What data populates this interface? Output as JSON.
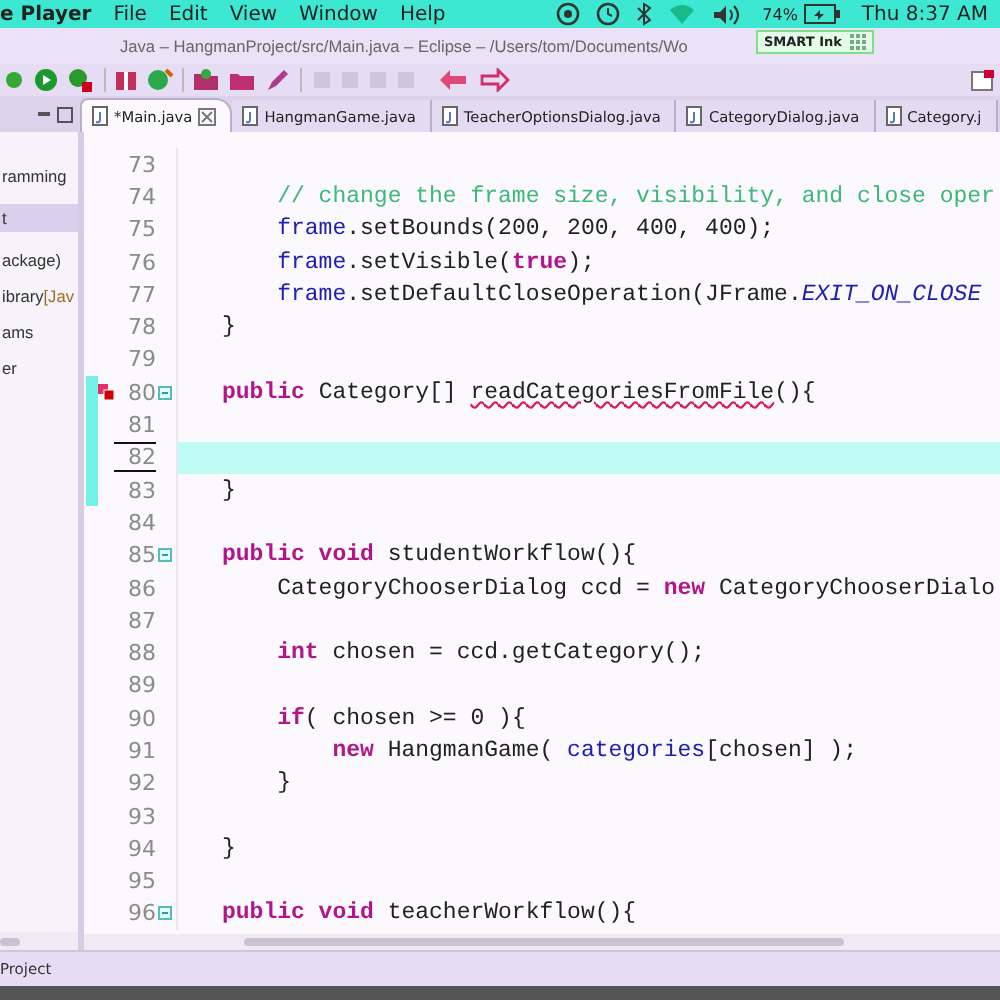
{
  "menu_bar": {
    "app": "e Player",
    "items": [
      "File",
      "Edit",
      "View",
      "Window",
      "Help"
    ],
    "battery": "74%",
    "clock": "Thu 8:37 AM"
  },
  "window": {
    "title": "Java – HangmanProject/src/Main.java – Eclipse – /Users/tom/Documents/Wo"
  },
  "overlay": {
    "title": "SMART Ink"
  },
  "tabs": [
    {
      "label": "*Main.java",
      "selected": true
    },
    {
      "label": "HangmanGame.java",
      "selected": false
    },
    {
      "label": "TeacherOptionsDialog.java",
      "selected": false
    },
    {
      "label": "CategoryDialog.java",
      "selected": false
    },
    {
      "label": "Category.j",
      "selected": false
    }
  ],
  "explorer": {
    "items": [
      {
        "label": "ramming",
        "selected": false
      },
      {
        "label": "t",
        "selected": true
      },
      {
        "label": "ackage)",
        "selected": false
      },
      {
        "label": "ibrary",
        "suffix": "[Jav",
        "selected": false
      },
      {
        "label": "ams",
        "selected": false
      },
      {
        "label": "er",
        "selected": false
      }
    ]
  },
  "editor": {
    "lines": [
      {
        "number": "73",
        "current": false,
        "fold": false,
        "marker": false
      },
      {
        "number": "74",
        "current": false,
        "fold": false,
        "marker": false,
        "segments": [
          {
            "text": "    // change the frame size, visibility, and close oper",
            "kind": "comment"
          }
        ]
      },
      {
        "number": "75",
        "current": false,
        "fold": false,
        "marker": false,
        "segments": [
          {
            "text": "    frame",
            "kind": "field"
          },
          {
            "text": ".setBounds(200, 200, 400, 400);",
            "kind": "plain"
          }
        ]
      },
      {
        "number": "76",
        "current": false,
        "fold": false,
        "marker": false,
        "segments": [
          {
            "text": "    frame",
            "kind": "field"
          },
          {
            "text": ".setVisible(",
            "kind": "plain"
          },
          {
            "text": "true",
            "kind": "keyword"
          },
          {
            "text": ");",
            "kind": "plain"
          }
        ]
      },
      {
        "number": "77",
        "current": false,
        "fold": false,
        "marker": false,
        "segments": [
          {
            "text": "    frame",
            "kind": "field"
          },
          {
            "text": ".setDefaultCloseOperation(JFrame.",
            "kind": "plain"
          },
          {
            "text": "EXIT_ON_CLOSE",
            "kind": "constant"
          }
        ]
      },
      {
        "number": "78",
        "current": false,
        "fold": false,
        "marker": false,
        "segments": [
          {
            "text": "}",
            "kind": "plain"
          }
        ]
      },
      {
        "number": "79",
        "current": false,
        "fold": false,
        "marker": false
      },
      {
        "number": "80",
        "current": false,
        "fold": true,
        "marker": true,
        "segments": [
          {
            "text": "public",
            "kind": "keyword"
          },
          {
            "text": " Category[] ",
            "kind": "plain"
          },
          {
            "text": "readCategoriesFromFile",
            "kind": "warning"
          },
          {
            "text": "(){",
            "kind": "plain"
          }
        ]
      },
      {
        "number": "81",
        "current": false,
        "fold": false,
        "marker": false
      },
      {
        "number": "82",
        "current": true,
        "fold": false,
        "marker": false
      },
      {
        "number": "83",
        "current": false,
        "fold": false,
        "marker": false,
        "segments": [
          {
            "text": "}",
            "kind": "plain"
          }
        ]
      },
      {
        "number": "84",
        "current": false,
        "fold": false,
        "marker": false
      },
      {
        "number": "85",
        "current": false,
        "fold": true,
        "marker": false,
        "segments": [
          {
            "text": "public void",
            "kind": "keyword"
          },
          {
            "text": " studentWorkflow(){",
            "kind": "plain"
          }
        ]
      },
      {
        "number": "86",
        "current": false,
        "fold": false,
        "marker": false,
        "segments": [
          {
            "text": "    CategoryChooserDialog ccd = ",
            "kind": "plain"
          },
          {
            "text": "new",
            "kind": "keyword"
          },
          {
            "text": " CategoryChooserDialo",
            "kind": "plain"
          }
        ]
      },
      {
        "number": "87",
        "current": false,
        "fold": false,
        "marker": false
      },
      {
        "number": "88",
        "current": false,
        "fold": false,
        "marker": false,
        "segments": [
          {
            "text": "    int",
            "kind": "keyword"
          },
          {
            "text": " chosen = ccd.getCategory();",
            "kind": "plain"
          }
        ]
      },
      {
        "number": "89",
        "current": false,
        "fold": false,
        "marker": false
      },
      {
        "number": "90",
        "current": false,
        "fold": false,
        "marker": false,
        "segments": [
          {
            "text": "    if",
            "kind": "keyword"
          },
          {
            "text": "( chosen >= 0 ){",
            "kind": "plain"
          }
        ]
      },
      {
        "number": "91",
        "current": false,
        "fold": false,
        "marker": false,
        "segments": [
          {
            "text": "        new",
            "kind": "keyword"
          },
          {
            "text": " HangmanGame( ",
            "kind": "plain"
          },
          {
            "text": "categories",
            "kind": "field"
          },
          {
            "text": "[chosen] );",
            "kind": "plain"
          }
        ]
      },
      {
        "number": "92",
        "current": false,
        "fold": false,
        "marker": false,
        "segments": [
          {
            "text": "    }",
            "kind": "plain"
          }
        ]
      },
      {
        "number": "93",
        "current": false,
        "fold": false,
        "marker": false
      },
      {
        "number": "94",
        "current": false,
        "fold": false,
        "marker": false,
        "segments": [
          {
            "text": "}",
            "kind": "plain"
          }
        ]
      },
      {
        "number": "95",
        "current": false,
        "fold": false,
        "marker": false
      },
      {
        "number": "96",
        "current": false,
        "fold": true,
        "marker": false,
        "segments": [
          {
            "text": "public void",
            "kind": "keyword"
          },
          {
            "text": " teacherWorkflow(){",
            "kind": "plain"
          }
        ]
      }
    ]
  },
  "status_bar": {
    "text": "Project"
  }
}
